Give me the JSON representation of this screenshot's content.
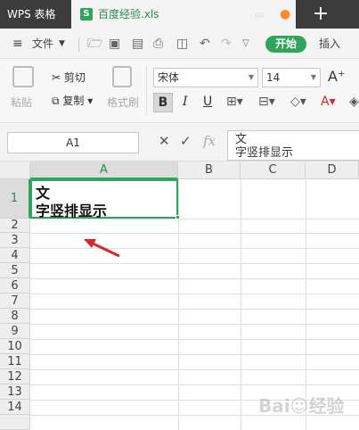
{
  "titlebar": {
    "app_name": "WPS 表格",
    "doc_name": "百度经验.xls",
    "doc_icon": "S"
  },
  "menubar": {
    "file_label": "文件",
    "start_label": "开始",
    "insert_label": "插入"
  },
  "ribbon": {
    "paste_label": "粘贴",
    "cut_label": "剪切",
    "copy_label": "复制",
    "format_painter_label": "格式刷",
    "font_name": "宋体",
    "font_size": "14",
    "bold": "B",
    "italic": "I",
    "underline": "U"
  },
  "formula_bar": {
    "cell_ref": "A1",
    "fx": "fx",
    "content_line1": "文",
    "content_line2": "字竖排显示"
  },
  "sheet": {
    "columns": [
      "A",
      "B",
      "C",
      "D"
    ],
    "rows": [
      "1",
      "2",
      "3",
      "4",
      "5",
      "6",
      "7",
      "8",
      "9",
      "10",
      "11",
      "12",
      "13",
      "14"
    ],
    "a1_line1": "文",
    "a1_line2": "字竖排显示"
  },
  "colors": {
    "accent": "#2ea55a",
    "titlebar": "#3c3c3c",
    "arrow": "#d22a2a"
  }
}
